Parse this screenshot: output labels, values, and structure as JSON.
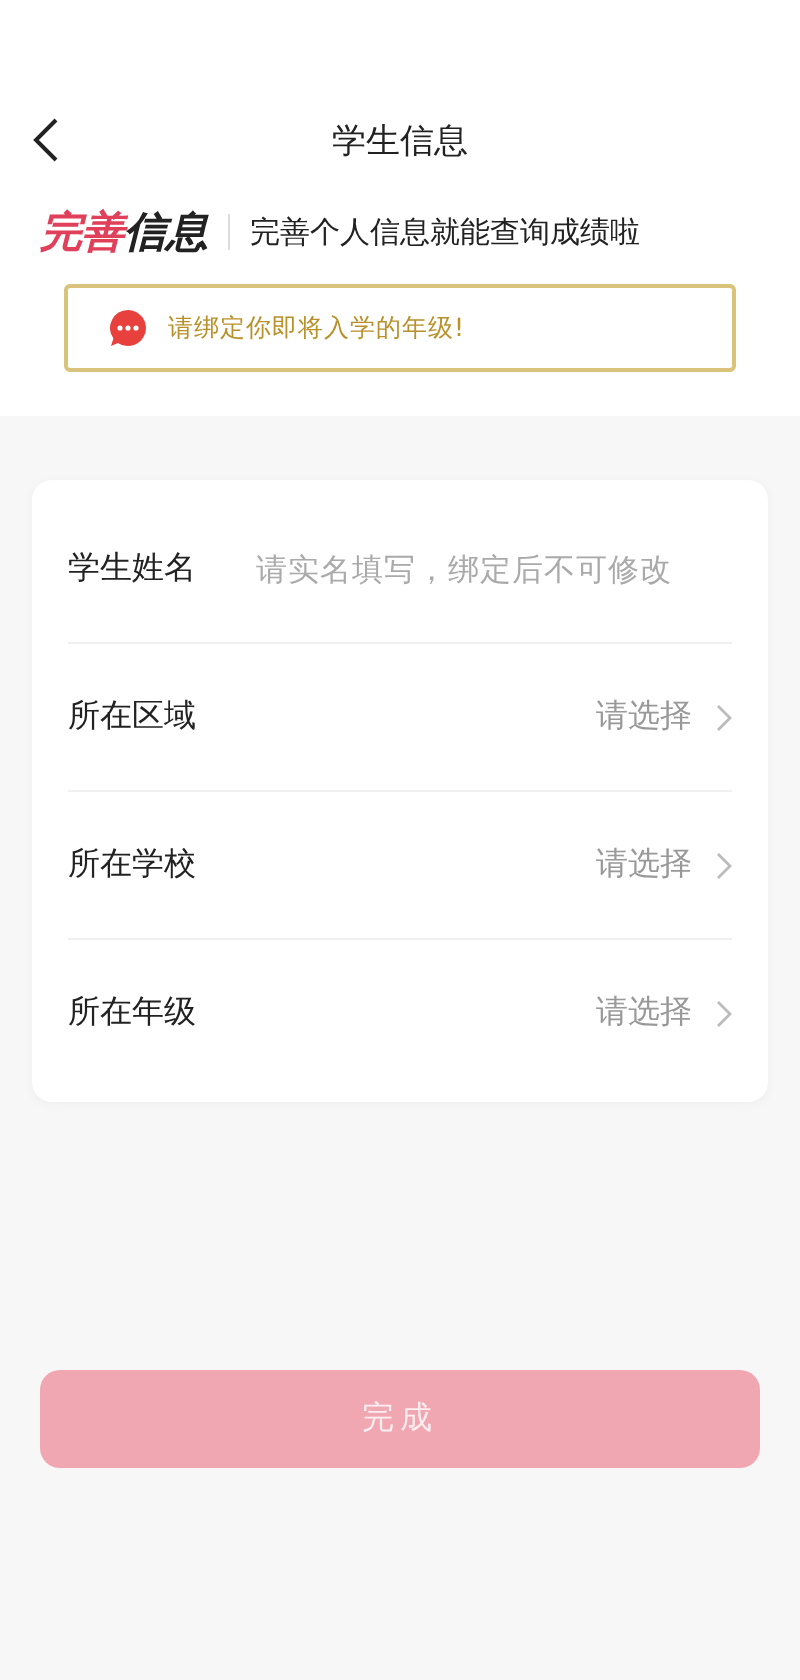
{
  "nav": {
    "title": "学生信息"
  },
  "heading": {
    "accent": "完善",
    "rest": "信息",
    "subtitle": "完善个人信息就能查询成绩啦"
  },
  "notice": {
    "text": "请绑定你即将入学的年级!"
  },
  "fields": [
    {
      "kind": "input",
      "label": "学生姓名",
      "placeholder": "请实名填写，绑定后不可修改"
    },
    {
      "kind": "select",
      "label": "所在区域",
      "value": "请选择"
    },
    {
      "kind": "select",
      "label": "所在学校",
      "value": "请选择"
    },
    {
      "kind": "select",
      "label": "所在年级",
      "value": "请选择"
    }
  ],
  "submit": {
    "label": "完成",
    "disabled": true
  }
}
